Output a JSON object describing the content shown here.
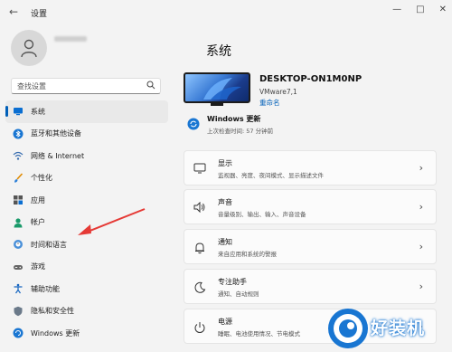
{
  "window": {
    "title": "设置",
    "controls": [
      "—",
      "□",
      "✕"
    ]
  },
  "sidebar": {
    "search_placeholder": "查找设置",
    "items": [
      {
        "label": "系统",
        "icon": "monitor-icon",
        "active": true
      },
      {
        "label": "蓝牙和其他设备",
        "icon": "bluetooth-icon"
      },
      {
        "label": "网络 & Internet",
        "icon": "wifi-icon"
      },
      {
        "label": "个性化",
        "icon": "brush-icon"
      },
      {
        "label": "应用",
        "icon": "apps-icon"
      },
      {
        "label": "帐户",
        "icon": "person-icon"
      },
      {
        "label": "时间和语言",
        "icon": "globe-clock-icon"
      },
      {
        "label": "游戏",
        "icon": "gamepad-icon"
      },
      {
        "label": "辅助功能",
        "icon": "accessibility-icon"
      },
      {
        "label": "隐私和安全性",
        "icon": "shield-icon"
      },
      {
        "label": "Windows 更新",
        "icon": "update-icon"
      }
    ]
  },
  "main": {
    "title": "系统",
    "device": {
      "name": "DESKTOP-ON1M0NP",
      "model": "VMware7,1",
      "rename": "重命名"
    },
    "update": {
      "title": "Windows 更新",
      "subtitle": "上次检查时间: 57 分钟前"
    },
    "cards": [
      {
        "title": "显示",
        "subtitle": "监视器、亮度、夜间模式、显示描述文件",
        "icon": "display-icon"
      },
      {
        "title": "声音",
        "subtitle": "音量级别、输出、输入、声音设备",
        "icon": "speaker-icon"
      },
      {
        "title": "通知",
        "subtitle": "来自应用和系统的警报",
        "icon": "bell-icon"
      },
      {
        "title": "专注助手",
        "subtitle": "通知、自动规则",
        "icon": "moon-icon"
      },
      {
        "title": "电源",
        "subtitle": "睡眠、电池使用情况、节电模式",
        "icon": "power-icon"
      }
    ]
  },
  "watermark": {
    "text": "好装机"
  },
  "colors": {
    "accent": "#005fb8",
    "annotation_arrow": "#e53935"
  }
}
